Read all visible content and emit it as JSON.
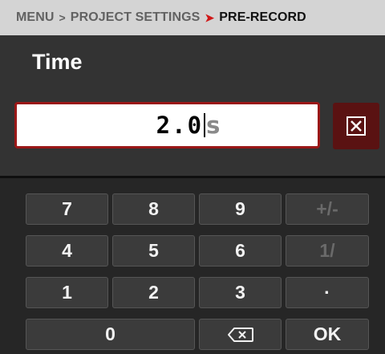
{
  "breadcrumb": {
    "items": [
      "MENU",
      "PROJECT SETTINGS",
      "PRE-RECORD"
    ],
    "separator": "›"
  },
  "page": {
    "title": "Time"
  },
  "input": {
    "value": "2.0",
    "unit": "s"
  },
  "clear_button": {
    "icon": "clear-x-box-icon"
  },
  "keypad": {
    "row1": [
      "7",
      "8",
      "9",
      "+/-"
    ],
    "row2": [
      "4",
      "5",
      "6",
      "1/"
    ],
    "row3": [
      "1",
      "2",
      "3",
      "·"
    ],
    "zero": "0",
    "backspace_icon": "backspace-icon",
    "ok": "OK"
  },
  "colors": {
    "accent_red": "#d01818",
    "field_border": "#9a1818",
    "clear_bg": "#5a1212"
  }
}
